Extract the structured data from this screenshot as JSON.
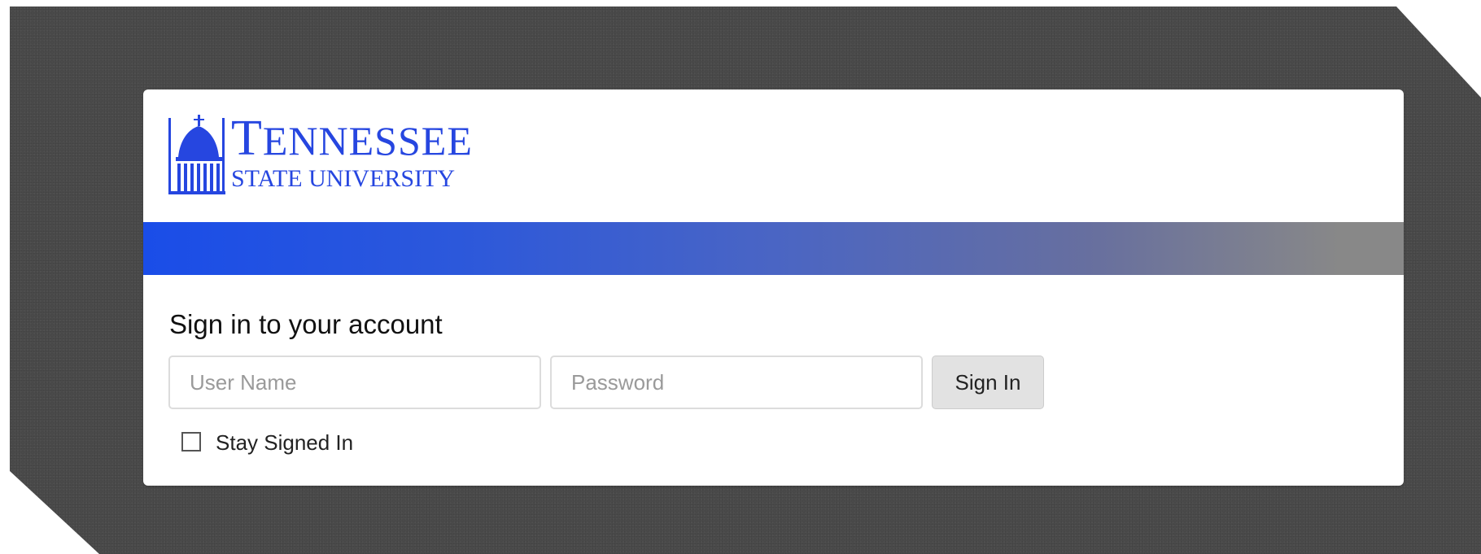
{
  "brand": {
    "line1": "Tennessee",
    "line2": "State University",
    "color": "#2646e0"
  },
  "banner": {
    "gradient_start": "#1a4de8",
    "gradient_end": "#888888"
  },
  "login": {
    "heading": "Sign in to your account",
    "username_placeholder": "User Name",
    "username_value": "",
    "password_placeholder": "Password",
    "password_value": "",
    "submit_label": "Sign In",
    "stay_signed_in_label": "Stay Signed In",
    "stay_signed_in_checked": false
  },
  "icons": {
    "logo": "university-building-icon"
  }
}
